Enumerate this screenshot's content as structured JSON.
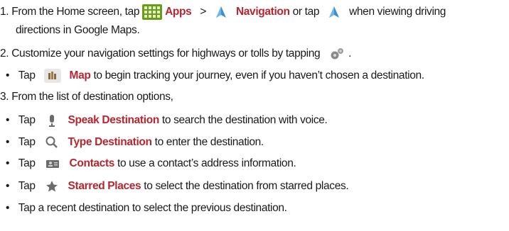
{
  "step1": {
    "number": "1.",
    "text_a": "From the Home screen, tap",
    "apps_label": "Apps",
    "separator": ">",
    "navigation_label": "Navigation",
    "text_b": "or tap",
    "text_c": "when viewing driving",
    "text_d": "directions in Google Maps."
  },
  "step2": {
    "number": "2.",
    "text": "Customize your navigation settings for highways or tolls by tapping",
    "end": ".",
    "tap_text": "Tap",
    "map_label": "Map",
    "map_desc": "to begin tracking your journey, even if you haven’t chosen a destination."
  },
  "step3": {
    "number": "3.",
    "text": "From the list of destination options,",
    "items": [
      {
        "tap": "Tap",
        "label": "Speak Destination",
        "desc": "to search the destination with voice."
      },
      {
        "tap": "Tap",
        "label": "Type Destination",
        "desc": "to enter the destination."
      },
      {
        "tap": "Tap",
        "label": "Contacts",
        "desc": "to use a contact’s address information."
      },
      {
        "tap": "Tap",
        "label": "Starred Places",
        "desc": "to select the destination from starred places."
      }
    ],
    "last": "Tap a recent destination to select the previous destination."
  },
  "colors": {
    "accent": "#b7262f",
    "text": "#1a1a1a",
    "apps_icon": "#6a9c1c",
    "nav_icon": "#3a8fd6"
  }
}
